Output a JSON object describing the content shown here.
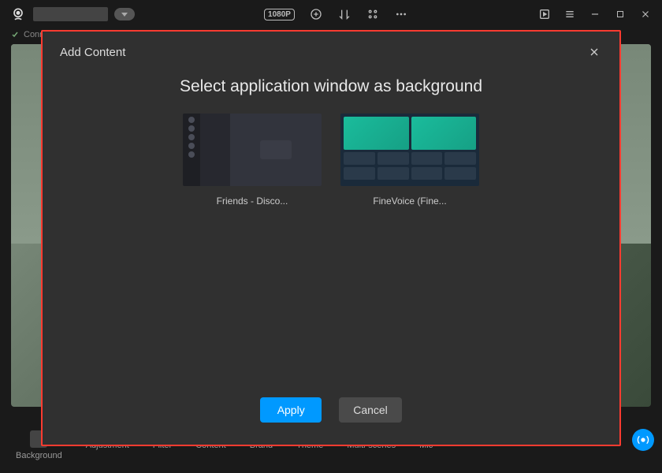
{
  "status": {
    "text": "Connected"
  },
  "titlebar": {
    "resolution": "1080P"
  },
  "dialog": {
    "header": "Add Content",
    "title": "Select application window as background",
    "windows": [
      {
        "label": "Friends - Disco..."
      },
      {
        "label": "FineVoice (Fine..."
      }
    ],
    "apply": "Apply",
    "cancel": "Cancel"
  },
  "toolbar": {
    "items": [
      "Background",
      "Adjustment",
      "Filter",
      "Content",
      "Brand",
      "Theme",
      "Multi-scenes",
      "Mic"
    ]
  }
}
